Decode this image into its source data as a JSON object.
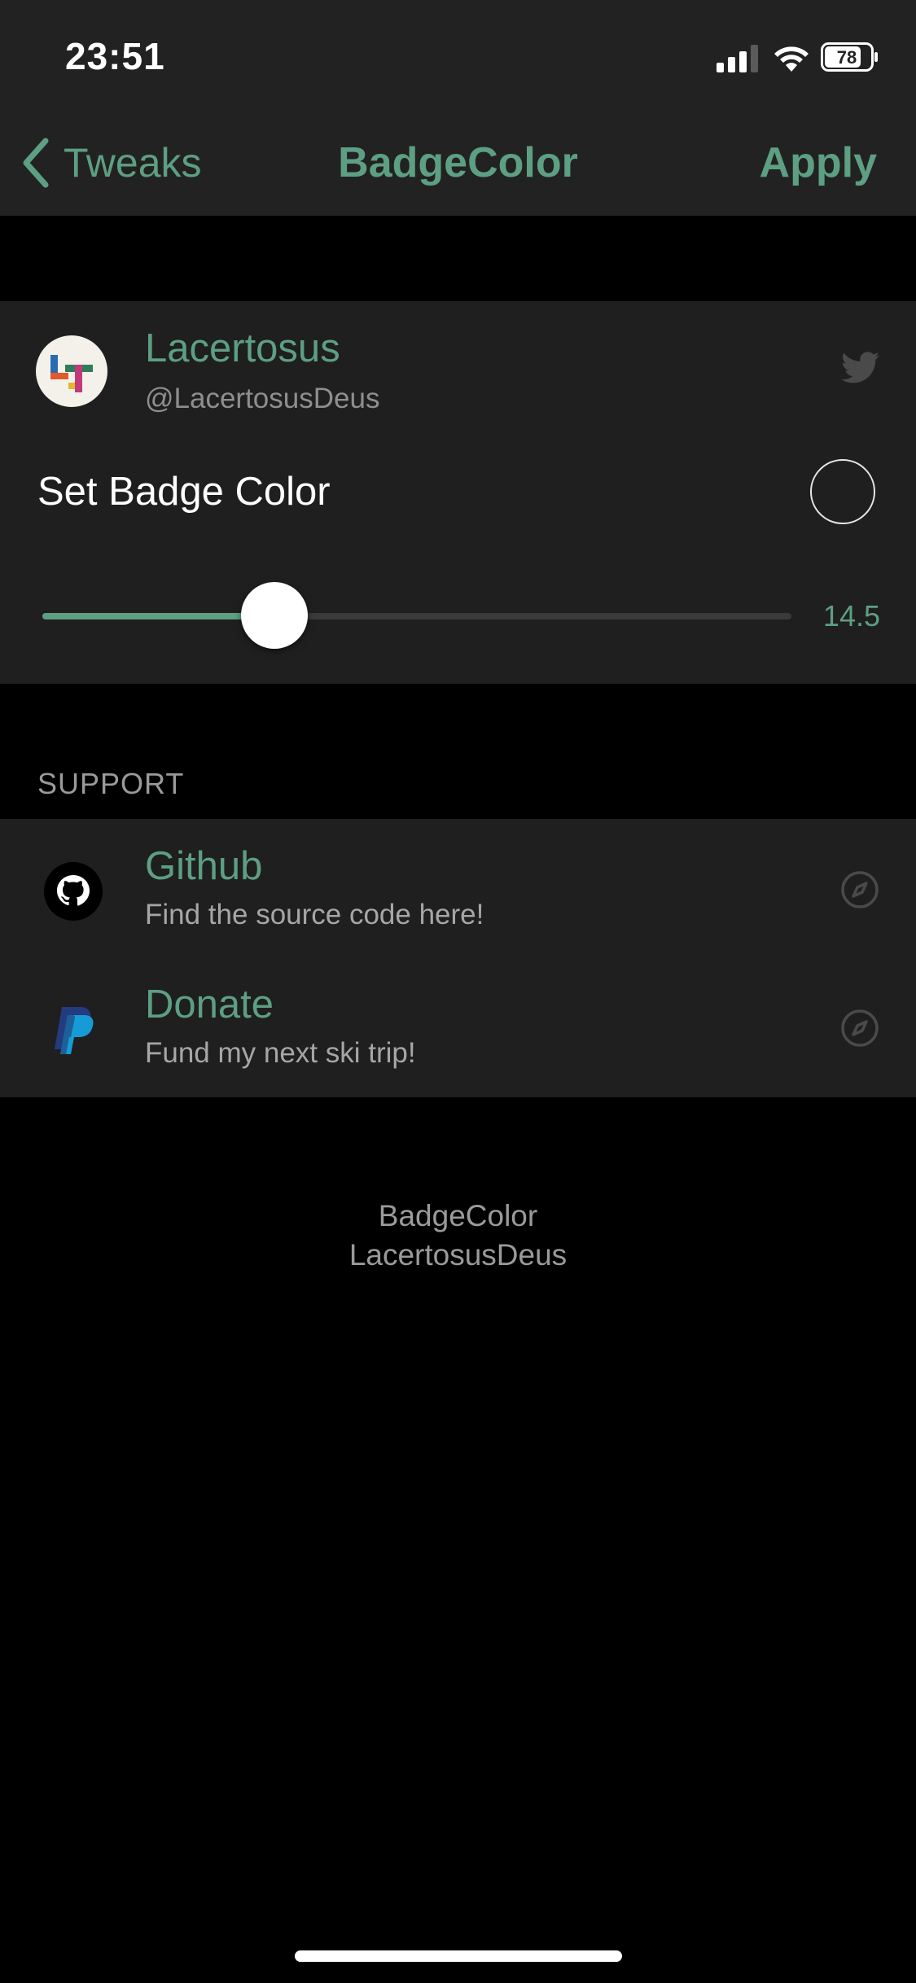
{
  "status_bar": {
    "time": "23:51",
    "battery": "78"
  },
  "nav": {
    "back_label": "Tweaks",
    "title": "BadgeColor",
    "action": "Apply"
  },
  "profile": {
    "name": "Lacertosus",
    "handle": "@LacertosusDeus"
  },
  "badge": {
    "label": "Set Badge Color",
    "slider_value": "14.5",
    "slider_fraction": 0.31
  },
  "support": {
    "header": "SUPPORT",
    "items": [
      {
        "title": "Github",
        "subtitle": "Find the source code here!"
      },
      {
        "title": "Donate",
        "subtitle": "Fund my next ski trip!"
      }
    ]
  },
  "footer": {
    "line1": "BadgeColor",
    "line2": "LacertosusDeus"
  },
  "colors": {
    "accent": "#5d9f82",
    "background": "#000000",
    "cell": "#1f1f1f",
    "bar": "#222222"
  }
}
